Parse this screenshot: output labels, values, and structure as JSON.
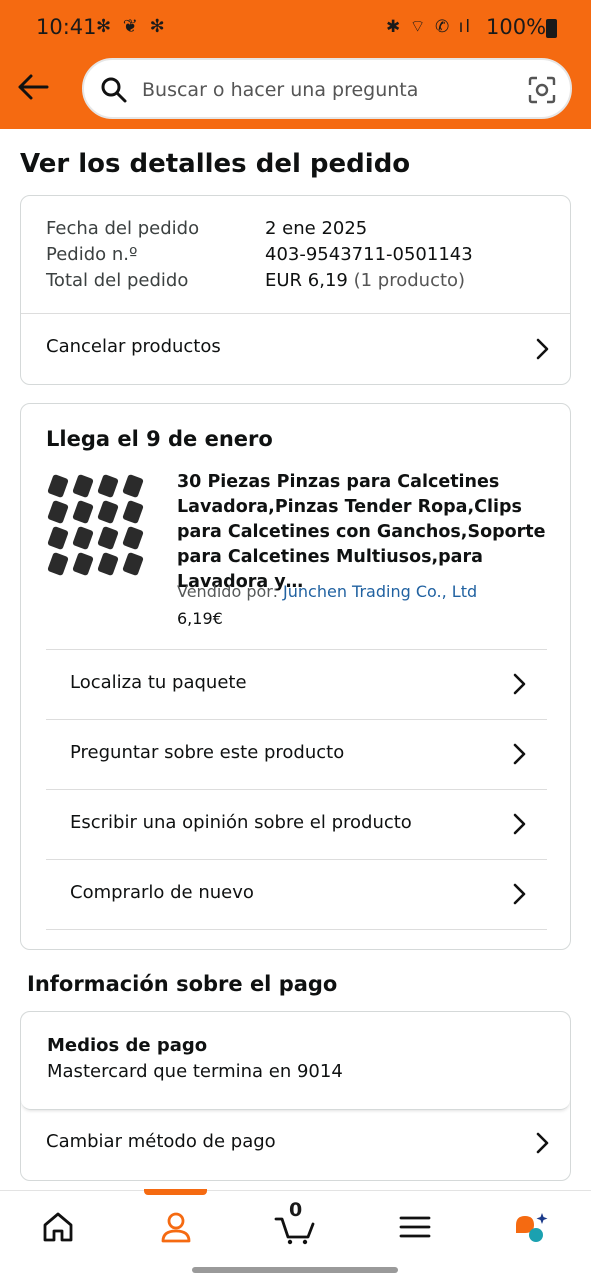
{
  "status_bar": {
    "time": "10:41",
    "notifications": "✻ ❦ ✻",
    "system_icons": "✱ ⌔ ✆ ıl",
    "battery": "100%"
  },
  "header": {
    "search_placeholder": "Buscar o hacer una pregunta"
  },
  "page": {
    "title": "Ver los detalles del pedido"
  },
  "order_summary": {
    "date_label": "Fecha del pedido",
    "date_value": "2 ene 2025",
    "number_label": "Pedido n.º",
    "number_value": "403-9543711-0501143",
    "total_label": "Total del pedido",
    "total_value": "EUR 6,19",
    "total_items": "(1 producto)",
    "cancel_label": "Cancelar productos"
  },
  "shipment": {
    "arrival": "Llega el 9 de enero",
    "product_title": "30 Piezas Pinzas para Calcetines Lavadora,Pinzas Tender Ropa,Clips para Calcetines con Ganchos,Soporte para Calcetines Multiusos,para Lavadora y…",
    "seller_prefix": "Vendido por:",
    "seller_name": "Junchen Trading Co., Ltd",
    "price": "6,19€",
    "actions": [
      "Localiza tu paquete",
      "Preguntar sobre este producto",
      "Escribir una opinión sobre el producto",
      "Comprarlo de nuevo"
    ]
  },
  "payment": {
    "heading": "Información sobre el pago",
    "method_title": "Medios de pago",
    "method_value": "Mastercard  que termina en 9014",
    "change_label": "Cambiar método de pago"
  },
  "bottom_nav": {
    "cart_count": "0",
    "active_tab": "account"
  },
  "colors": {
    "brand_orange": "#f56a11",
    "link_blue": "#2162a1"
  }
}
